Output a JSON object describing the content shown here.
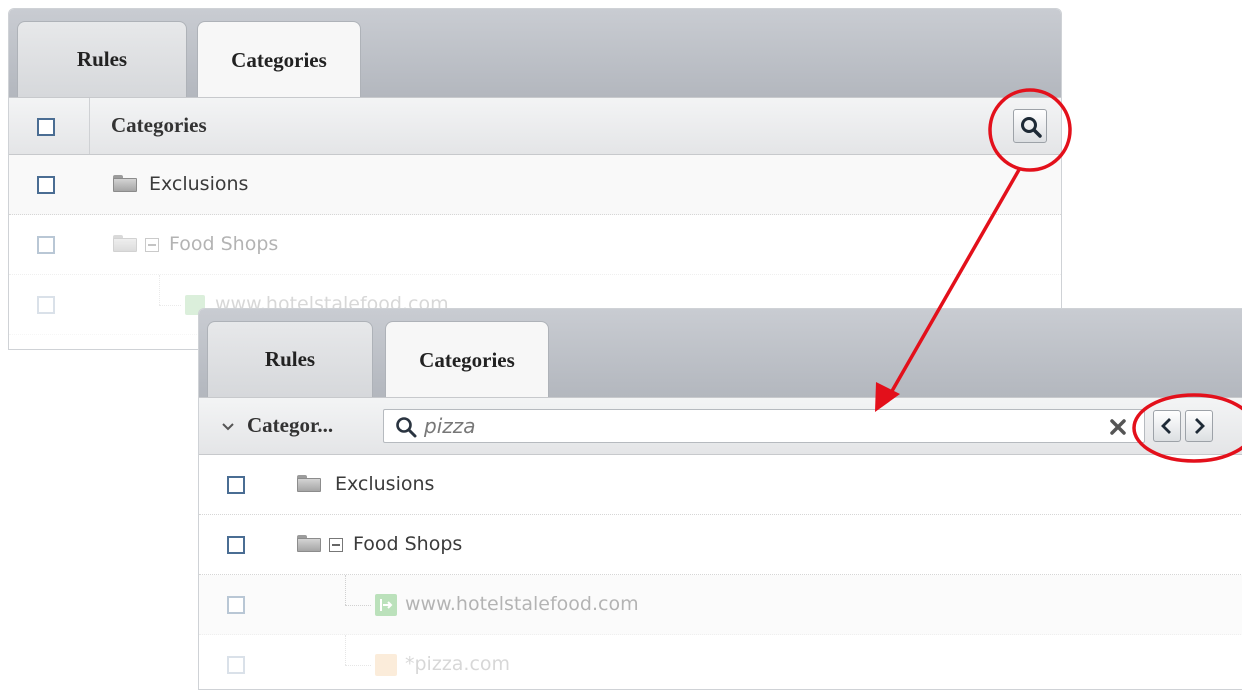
{
  "back_panel": {
    "tabs": [
      {
        "label": "Rules",
        "active": false
      },
      {
        "label": "Categories",
        "active": true
      }
    ],
    "header_label": "Categories",
    "rows": [
      {
        "label": "Exclusions",
        "icon": "folder-icon"
      },
      {
        "label": "Food Shops",
        "icon": "folder-icon",
        "expanded": true
      },
      {
        "label": "www.hotelstalefood.com",
        "icon": "redirect-icon"
      }
    ]
  },
  "front_panel": {
    "tabs": [
      {
        "label": "Rules",
        "active": false
      },
      {
        "label": "Categories",
        "active": true
      }
    ],
    "header_label": "Categor...",
    "search": {
      "value": "pizza",
      "placeholder": ""
    },
    "rows": [
      {
        "label": "Exclusions",
        "icon": "folder-icon"
      },
      {
        "label": "Food Shops",
        "icon": "folder-icon",
        "expanded": true
      },
      {
        "label": "www.hotelstalefood.com",
        "icon": "redirect-icon"
      },
      {
        "label": "*pizza.com",
        "icon": "wildcard-icon"
      }
    ]
  },
  "colors": {
    "annotation_red": "#e3101b",
    "checkbox_border": "#4a6d93",
    "redirect_icon_green": "#4fb34f",
    "wildcard_icon_orange": "#f0a24a"
  }
}
